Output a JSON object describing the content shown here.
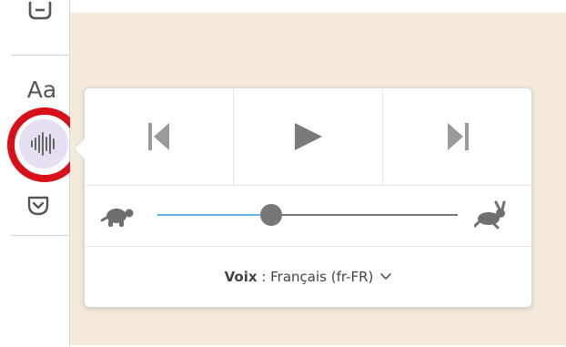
{
  "toolbar": {
    "font_button_label": "Aa",
    "icons": [
      "list-icon",
      "waveform-icon",
      "pocket-icon"
    ]
  },
  "narrate": {
    "icons": [
      "previous-icon",
      "play-icon",
      "next-icon",
      "turtle-icon",
      "rabbit-icon",
      "chevron-down-icon"
    ],
    "speed_value": 0.38,
    "voice_label": "Voix",
    "voice_separator": " : ",
    "voice_value": "Français (fr-FR)"
  },
  "colors": {
    "highlight_ring": "#d7101a",
    "slider_fill": "#5fb4e3",
    "content_background": "#f3eadb",
    "active_button": "#e6dff1"
  }
}
